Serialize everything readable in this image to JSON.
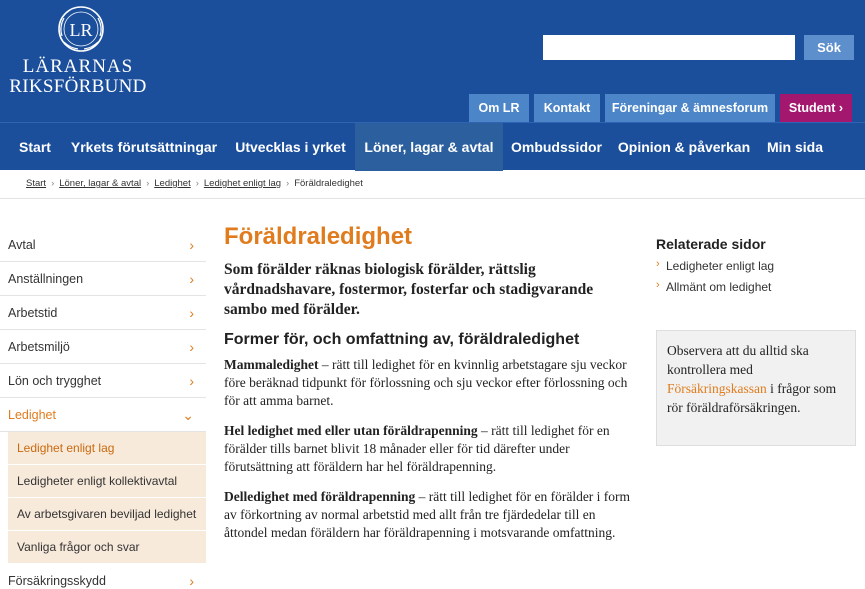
{
  "logo": {
    "line1": "LÄRARNAS",
    "line2": "RIKSFÖRBUND",
    "monogram": "LR"
  },
  "search": {
    "placeholder": "",
    "button_label": "Sök"
  },
  "top_links": [
    {
      "label": "Om LR"
    },
    {
      "label": "Kontakt"
    },
    {
      "label": "Föreningar & ämnesforum"
    },
    {
      "label": "Student ›"
    }
  ],
  "nav": [
    {
      "label": "Start"
    },
    {
      "label": "Yrkets förutsättningar"
    },
    {
      "label": "Utvecklas i yrket"
    },
    {
      "label": "Löner, lagar & avtal"
    },
    {
      "label": "Ombudssidor"
    },
    {
      "label": "Opinion & påverkan"
    },
    {
      "label": "Min sida"
    }
  ],
  "breadcrumb": [
    {
      "label": "Start"
    },
    {
      "label": "Löner, lagar & avtal"
    },
    {
      "label": "Ledighet"
    },
    {
      "label": "Ledighet enligt lag"
    },
    {
      "label": "Föräldraledighet"
    }
  ],
  "sidebar": {
    "items": [
      {
        "label": "Avtal",
        "chevron": "›"
      },
      {
        "label": "Anställningen",
        "chevron": "›"
      },
      {
        "label": "Arbetstid",
        "chevron": "›"
      },
      {
        "label": "Arbetsmiljö",
        "chevron": "›"
      },
      {
        "label": "Lön och trygghet",
        "chevron": "›"
      },
      {
        "label": "Ledighet",
        "chevron": "⌄"
      }
    ],
    "subitems": [
      {
        "label": "Ledighet enligt lag"
      },
      {
        "label": "Ledigheter enligt kollektivavtal"
      },
      {
        "label": "Av arbetsgivaren beviljad ledighet"
      },
      {
        "label": "Vanliga frågor och svar"
      }
    ],
    "after": [
      {
        "label": "Försäkringsskydd",
        "chevron": "›"
      }
    ]
  },
  "main": {
    "title": "Föräldraledighet",
    "lead": "Som förälder räknas biologisk förälder, rättslig vårdnadshavare, fostermor, fosterfar och stadigvarande sambo med förälder.",
    "section_heading": "Former för, och omfattning av, föräldraledighet",
    "paragraphs": [
      {
        "term": "Mammaledighet",
        "text": " – rätt till ledighet för en kvinnlig arbetstagare sju veckor före beräknad tidpunkt för förlossning och sju veckor efter förlossning och för att amma barnet."
      },
      {
        "term": "Hel ledighet med eller utan föräldrapenning",
        "text": " – rätt till ledighet för en förälder tills barnet blivit 18 månader eller för tid därefter under förutsättning att föräldern har hel föräldrapenning."
      },
      {
        "term": "Delledighet med föräldrapenning",
        "text": " – rätt till ledighet för en förälder i form av förkortning av normal arbetstid med allt från tre fjärdedelar till en åttondel medan föräldern har föräldrapenning i motsvarande omfattning."
      }
    ]
  },
  "related": {
    "heading": "Relaterade sidor",
    "links": [
      {
        "label": "Ledigheter enligt lag"
      },
      {
        "label": "Allmänt om ledighet"
      }
    ],
    "bullet": "›"
  },
  "note": {
    "before": "Observera att du alltid ska kontrollera med ",
    "link": "Försäkringskassan",
    "after": " i frågor som rör föräldraförsäkringen."
  },
  "colors": {
    "header": "#1b4f9c",
    "accent": "#e07c1e",
    "student": "#a3176f",
    "top_link": "#4c86c8"
  }
}
